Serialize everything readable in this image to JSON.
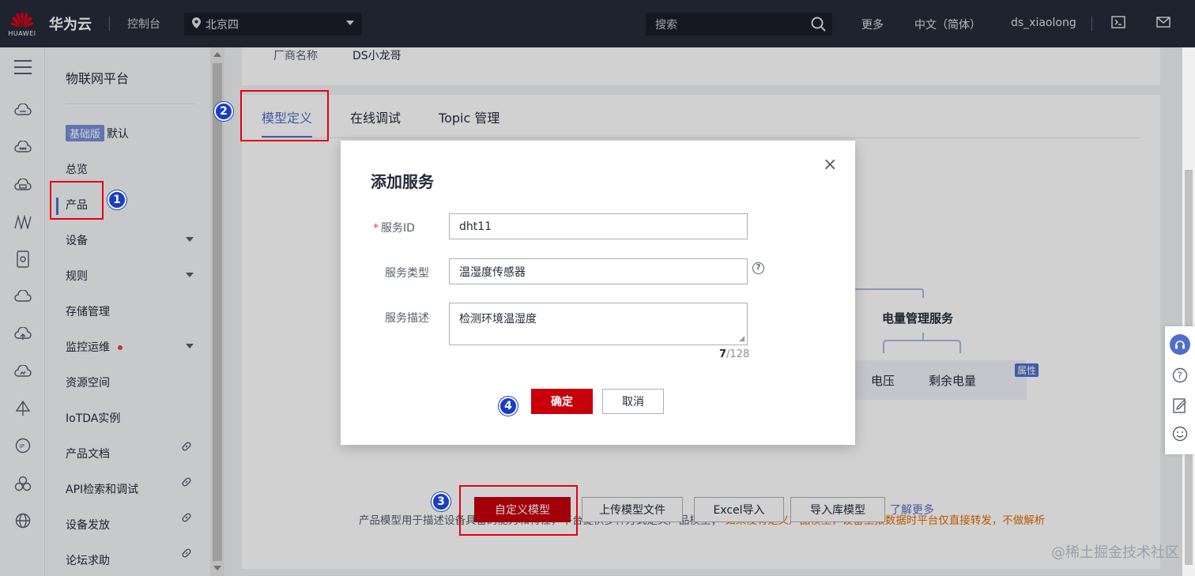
{
  "header": {
    "logo_text": "HUAWEI",
    "brand": "华为云",
    "console": "控制台",
    "region": "北京四",
    "search_placeholder": "搜索",
    "more": "更多",
    "language": "中文（简体）",
    "username": "ds_xiaolong"
  },
  "sidebar": {
    "title": "物联网平台",
    "edition_badge": "基础版",
    "edition_label": "默认",
    "items": [
      {
        "label": "总览"
      },
      {
        "label": "产品"
      },
      {
        "label": "设备"
      },
      {
        "label": "规则"
      },
      {
        "label": "存储管理"
      },
      {
        "label": "监控运维"
      },
      {
        "label": "资源空间"
      },
      {
        "label": "IoTDA实例"
      },
      {
        "label": "产品文档"
      },
      {
        "label": "API检索和调试"
      },
      {
        "label": "设备发放"
      },
      {
        "label": "论坛求助"
      }
    ]
  },
  "product_info": {
    "vendor_label": "厂商名称",
    "vendor_value": "DS小龙哥"
  },
  "tabs": [
    {
      "label": "模型定义"
    },
    {
      "label": "在线调试"
    },
    {
      "label": "Topic 管理"
    }
  ],
  "diagram": {
    "service": "电量管理服务",
    "items": [
      "电压",
      "剩余电量"
    ],
    "attr_badge": "属性"
  },
  "model": {
    "description": "产品模型用于描述设备具备的能力和特性，平台提供多种方式定义产品模型；",
    "warning": "如果没有定义产品模型，设备上报数据时平台仅直接转发，不做解析",
    "buttons": {
      "custom": "自定义模型",
      "upload": "上传模型文件",
      "excel": "Excel导入",
      "import_lib": "导入库模型",
      "learn_more": "了解更多"
    }
  },
  "dialog": {
    "title": "添加服务",
    "service_id_label": "服务ID",
    "service_id_value": "dht11",
    "service_type_label": "服务类型",
    "service_type_value": "温湿度传感器",
    "service_desc_label": "服务描述",
    "service_desc_value": "检测环境温湿度",
    "counter_current": "7",
    "counter_max": "/128",
    "ok": "确定",
    "cancel": "取消"
  },
  "annotations": [
    "1",
    "2",
    "3",
    "4"
  ],
  "watermark": "@稀土掘金技术社区",
  "colors": {
    "header_bg": "#252b3a",
    "primary_red": "#c7000b",
    "accent_blue": "#526ecc",
    "annotation_red": "#e60012",
    "annotation_badge": "#1a3ec2"
  }
}
